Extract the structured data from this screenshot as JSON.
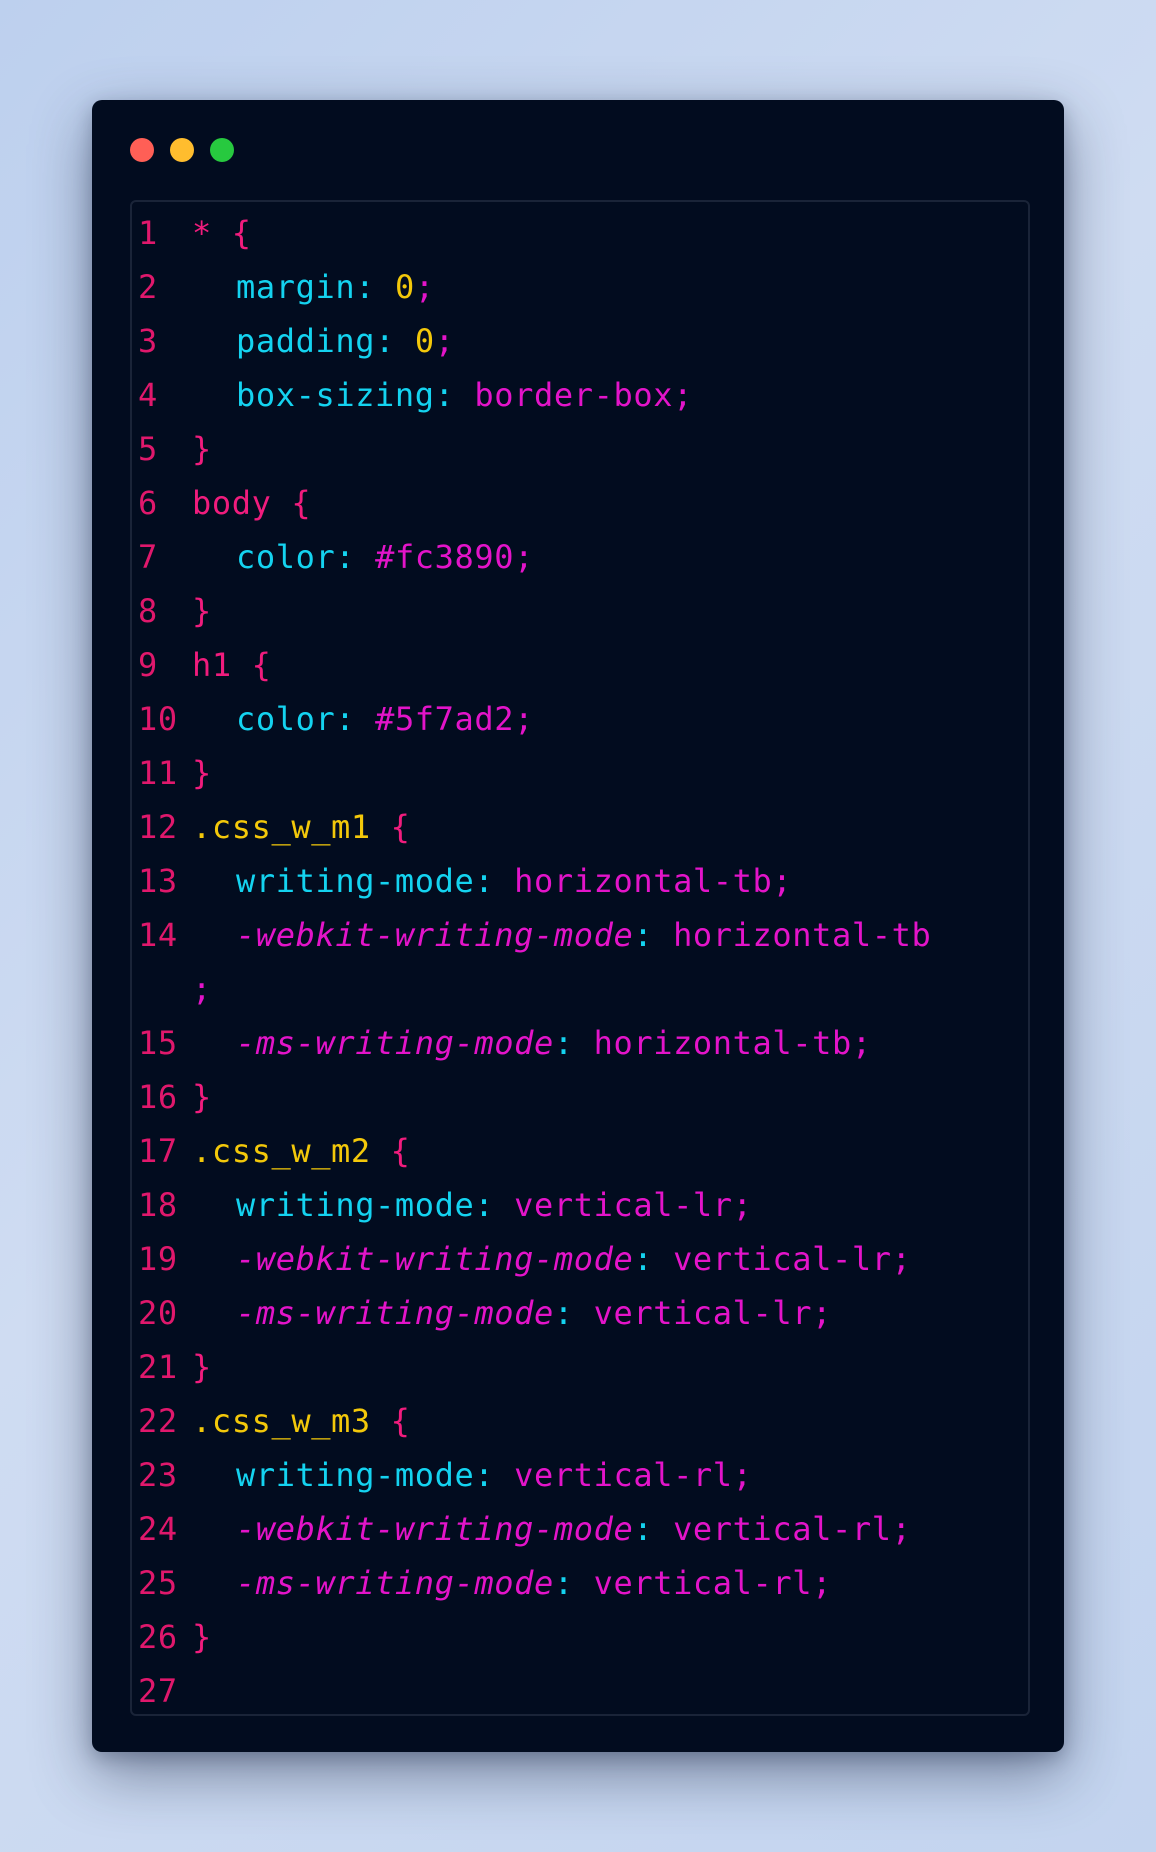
{
  "window": {
    "controls": [
      {
        "name": "close",
        "color": "#ff5f56"
      },
      {
        "name": "minimize",
        "color": "#ffbd2e"
      },
      {
        "name": "maximize",
        "color": "#27c93f"
      }
    ]
  },
  "code": {
    "lines": [
      {
        "n": "1",
        "sel": "*",
        "open": "{"
      },
      {
        "n": "2",
        "prop": "margin",
        "colon": ":",
        "num": "0",
        "semi": ";"
      },
      {
        "n": "3",
        "prop": "padding",
        "colon": ":",
        "num": "0",
        "semi": ";"
      },
      {
        "n": "4",
        "prop": "box-sizing",
        "colon": ":",
        "val": "border-box",
        "semi": ";"
      },
      {
        "n": "5",
        "close": "}"
      },
      {
        "n": "6",
        "sel": "body",
        "open": "{"
      },
      {
        "n": "7",
        "prop": "color",
        "colon": ":",
        "val": "#fc3890",
        "semi": ";"
      },
      {
        "n": "8",
        "close": "}"
      },
      {
        "n": "9",
        "sel": "h1",
        "open": "{"
      },
      {
        "n": "10",
        "prop": "color",
        "colon": ":",
        "val": "#5f7ad2",
        "semi": ";"
      },
      {
        "n": "11",
        "close": "}"
      },
      {
        "n": "12",
        "cls": ".css_w_m1",
        "open": "{"
      },
      {
        "n": "13",
        "prop": "writing-mode",
        "colon": ":",
        "val": "horizontal-tb",
        "semi": ";"
      },
      {
        "n": "14",
        "vprop": "-webkit-writing-mode",
        "colon": ":",
        "val": "horizontal-tb"
      },
      {
        "n": "",
        "semi": ";"
      },
      {
        "n": "15",
        "vprop": "-ms-writing-mode",
        "colon": ":",
        "val": "horizontal-tb",
        "semi": ";"
      },
      {
        "n": "16",
        "close": "}"
      },
      {
        "n": "17",
        "cls": ".css_w_m2",
        "open": "{"
      },
      {
        "n": "18",
        "prop": "writing-mode",
        "colon": ":",
        "val": "vertical-lr",
        "semi": ";"
      },
      {
        "n": "19",
        "vprop": "-webkit-writing-mode",
        "colon": ":",
        "val": "vertical-lr",
        "semi": ";"
      },
      {
        "n": "20",
        "vprop": "-ms-writing-mode",
        "colon": ":",
        "val": "vertical-lr",
        "semi": ";"
      },
      {
        "n": "21",
        "close": "}"
      },
      {
        "n": "22",
        "cls": ".css_w_m3",
        "open": "{"
      },
      {
        "n": "23",
        "prop": "writing-mode",
        "colon": ":",
        "val": "vertical-rl",
        "semi": ";"
      },
      {
        "n": "24",
        "vprop": "-webkit-writing-mode",
        "colon": ":",
        "val": "vertical-rl",
        "semi": ";"
      },
      {
        "n": "25",
        "vprop": "-ms-writing-mode",
        "colon": ":",
        "val": "vertical-rl",
        "semi": ";"
      },
      {
        "n": "26",
        "close": "}"
      },
      {
        "n": "27"
      }
    ]
  }
}
